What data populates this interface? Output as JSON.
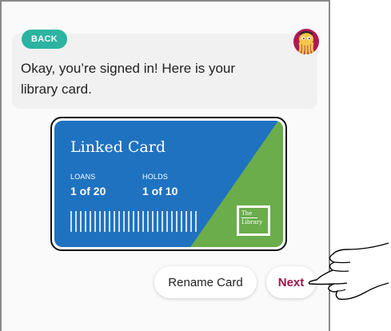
{
  "header": {
    "back_label": "BACK"
  },
  "message": {
    "text": "Okay, you’re signed in! Here is your library card."
  },
  "card": {
    "title": "Linked Card",
    "loans_label": "LOANS",
    "loans_value": "1 of 20",
    "holds_label": "HOLDS",
    "holds_value": "1 of 10",
    "library_logo_line1": "The",
    "library_logo_line2": "Library"
  },
  "actions": {
    "rename_label": "Rename Card",
    "next_label": "Next"
  },
  "colors": {
    "accent_teal": "#2cb3a1",
    "card_blue": "#1f72c0",
    "card_green": "#6aad4a",
    "next_text": "#a3154a"
  },
  "icons": {
    "avatar": "octopus-avatar-icon",
    "pointer": "pointing-hand-icon"
  }
}
